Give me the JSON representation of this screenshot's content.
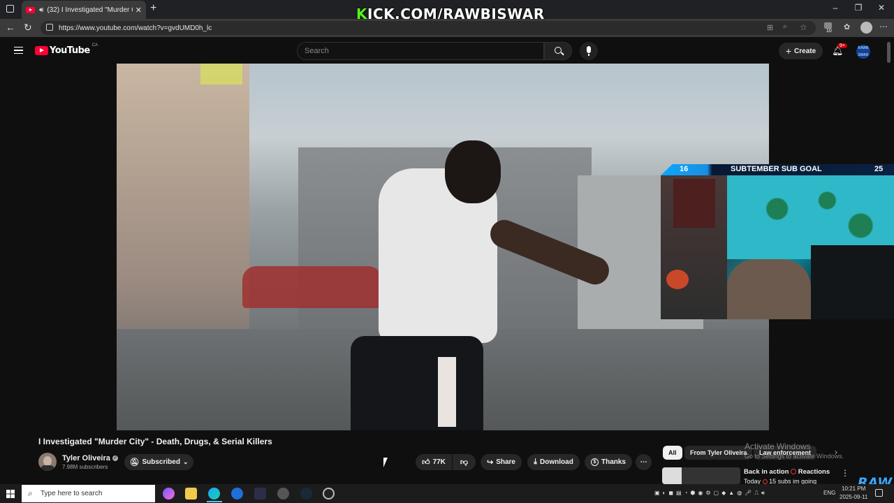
{
  "browser": {
    "tab_title": "(32) I Investigated \"Murder C",
    "url": "https://www.youtube.com/watch?v=gvdUMD0h_lc",
    "extension_badge": "10"
  },
  "overlay": {
    "kick_prefix": "K",
    "kick_rest": "ICK.COM/RAWBISWAR",
    "goal_current": "16",
    "goal_label": "SUBTEMBER SUB GOAL",
    "goal_target": "25",
    "corner_logo": "RAW"
  },
  "youtube": {
    "logo_text": "YouTube",
    "country": "CA",
    "search_placeholder": "Search",
    "create_label": "Create",
    "notif_badge": "9+",
    "avatar_text": "RAWB SWAR"
  },
  "video": {
    "title": "I Investigated \"Murder City\" - Death, Drugs, & Serial Killers",
    "channel": "Tyler Oliveira",
    "subscribers": "7.98M subscribers",
    "subscribed_label": "Subscribed",
    "likes": "77K",
    "share_label": "Share",
    "download_label": "Download",
    "thanks_label": "Thanks"
  },
  "sidebar": {
    "chips": [
      "All",
      "From Tyler Oliveira",
      "Law enforcement"
    ],
    "rec_title": "Back in action",
    "rec_title_suffix": "Reactions",
    "rec_meta": "Today",
    "rec_meta_suffix": "15 subs im going"
  },
  "windows": {
    "watermark_title": "Activate Windows",
    "watermark_sub": "Go to Settings to activate Windows.",
    "taskbar_search": "Type here to search",
    "lang": "ENG",
    "time": "10:21 PM",
    "date": "2025-09-11"
  }
}
